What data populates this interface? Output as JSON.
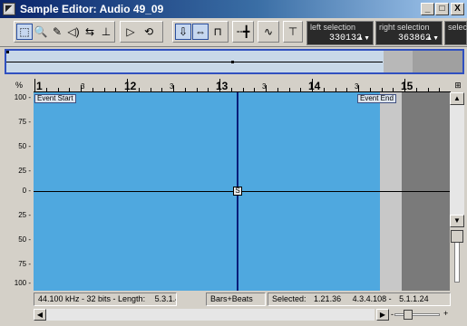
{
  "window": {
    "title": "Sample Editor: Audio 49_09",
    "minimize": "_",
    "maximize": "□",
    "close": "X"
  },
  "toolbar": {
    "tools": [
      {
        "name": "range-select-tool",
        "glyph": "⬚",
        "active": true
      },
      {
        "name": "zoom-tool",
        "glyph": "🔍",
        "active": false
      },
      {
        "name": "pencil-tool",
        "glyph": "✎",
        "active": false
      },
      {
        "name": "play-tool",
        "glyph": "◁)",
        "active": false
      },
      {
        "name": "scrub-tool",
        "glyph": "⇆",
        "active": false
      },
      {
        "name": "draw-tool",
        "glyph": "⊥",
        "active": false
      }
    ],
    "play_glyph": "▷",
    "loop_glyph": "⟲",
    "snap_glyphs": [
      "⇩",
      "⇔",
      "⊓"
    ],
    "hitpoint_glyph": "╌╋",
    "wave_glyph": "∿",
    "filter_glyph": "⊤",
    "left_selection": {
      "label": "left selection",
      "value": "330132"
    },
    "right_selection": {
      "label": "right selection",
      "value": "363862"
    },
    "select_label": "selec"
  },
  "ruler": {
    "corner": "%",
    "bars": [
      "1",
      "12",
      "13",
      "14",
      "15"
    ],
    "beats": [
      "3",
      "3",
      "3",
      "3"
    ],
    "control_glyph": "⊞"
  },
  "amplitude_axis": [
    "100 -",
    "75 -",
    "50 -",
    "25 -",
    "0 -",
    "25 -",
    "50 -",
    "75 -",
    "100 -"
  ],
  "markers": {
    "event_start": "Event Start",
    "event_end": "Event End"
  },
  "status": {
    "format": "44.100 kHz - 32 bits - Length:",
    "length": "5.3.1.47",
    "display_mode": "Bars+Beats",
    "selected_label": "Selected:",
    "selected_length": "1.21.36",
    "selected_start": "4.3.4.108 -",
    "selected_end": "5.1.1.24"
  },
  "colors": {
    "waveform_bg": "#4fa8df",
    "cursor": "#0a1e7a",
    "title_gradient_start": "#0a246a"
  }
}
